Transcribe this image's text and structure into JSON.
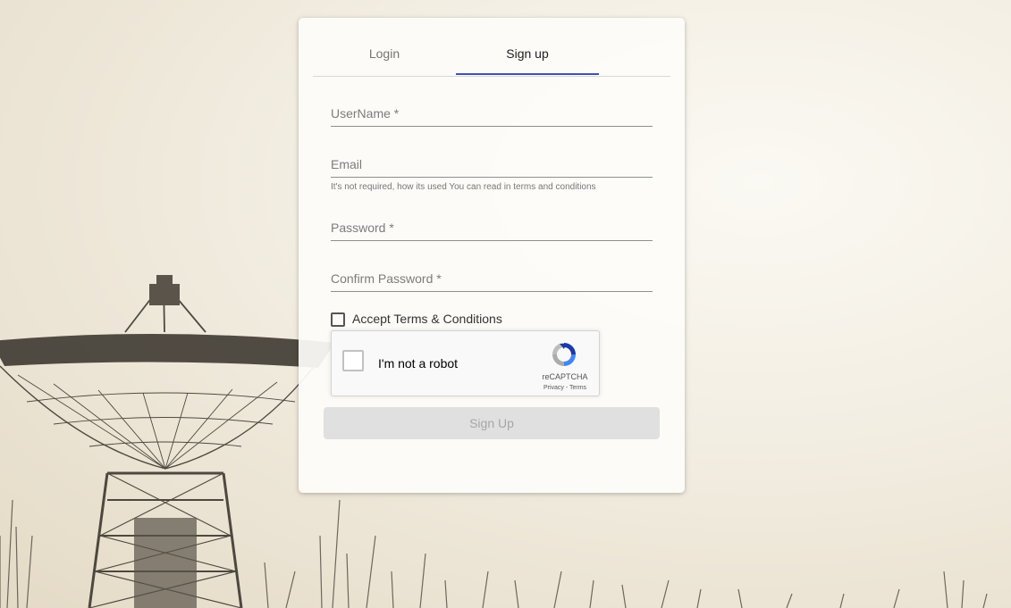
{
  "tabs": [
    {
      "label": "Login",
      "active": false
    },
    {
      "label": "Sign up",
      "active": true
    }
  ],
  "form": {
    "username": {
      "placeholder": "UserName *",
      "value": ""
    },
    "email": {
      "placeholder": "Email",
      "value": "",
      "hint": "It's not required, how its used You can read in terms and conditions"
    },
    "password": {
      "placeholder": "Password *",
      "value": ""
    },
    "confirm_password": {
      "placeholder": "Confirm Password *",
      "value": ""
    },
    "terms": {
      "label": "Accept Terms & Conditions",
      "checked": false
    },
    "captcha": {
      "label": "I'm not a robot",
      "brand": "reCAPTCHA",
      "privacy": "Privacy",
      "separator": " - ",
      "terms": "Terms"
    },
    "submit_label": "Sign Up",
    "submit_disabled": true
  },
  "colors": {
    "accent": "#3f51b5",
    "disabled_button_bg": "#e0e0e0",
    "disabled_button_text": "#a6a6a6"
  },
  "icons": {
    "captcha_logo": "recaptcha-logo-icon"
  }
}
